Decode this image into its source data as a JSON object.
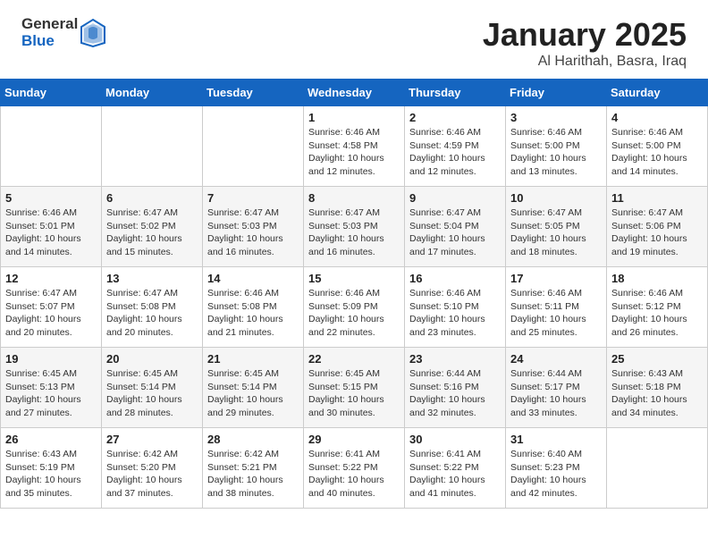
{
  "header": {
    "logo_general": "General",
    "logo_blue": "Blue",
    "title": "January 2025",
    "subtitle": "Al Harithah, Basra, Iraq"
  },
  "calendar": {
    "days_of_week": [
      "Sunday",
      "Monday",
      "Tuesday",
      "Wednesday",
      "Thursday",
      "Friday",
      "Saturday"
    ],
    "weeks": [
      [
        {
          "day": "",
          "info": ""
        },
        {
          "day": "",
          "info": ""
        },
        {
          "day": "",
          "info": ""
        },
        {
          "day": "1",
          "info": "Sunrise: 6:46 AM\nSunset: 4:58 PM\nDaylight: 10 hours\nand 12 minutes."
        },
        {
          "day": "2",
          "info": "Sunrise: 6:46 AM\nSunset: 4:59 PM\nDaylight: 10 hours\nand 12 minutes."
        },
        {
          "day": "3",
          "info": "Sunrise: 6:46 AM\nSunset: 5:00 PM\nDaylight: 10 hours\nand 13 minutes."
        },
        {
          "day": "4",
          "info": "Sunrise: 6:46 AM\nSunset: 5:00 PM\nDaylight: 10 hours\nand 14 minutes."
        }
      ],
      [
        {
          "day": "5",
          "info": "Sunrise: 6:46 AM\nSunset: 5:01 PM\nDaylight: 10 hours\nand 14 minutes."
        },
        {
          "day": "6",
          "info": "Sunrise: 6:47 AM\nSunset: 5:02 PM\nDaylight: 10 hours\nand 15 minutes."
        },
        {
          "day": "7",
          "info": "Sunrise: 6:47 AM\nSunset: 5:03 PM\nDaylight: 10 hours\nand 16 minutes."
        },
        {
          "day": "8",
          "info": "Sunrise: 6:47 AM\nSunset: 5:03 PM\nDaylight: 10 hours\nand 16 minutes."
        },
        {
          "day": "9",
          "info": "Sunrise: 6:47 AM\nSunset: 5:04 PM\nDaylight: 10 hours\nand 17 minutes."
        },
        {
          "day": "10",
          "info": "Sunrise: 6:47 AM\nSunset: 5:05 PM\nDaylight: 10 hours\nand 18 minutes."
        },
        {
          "day": "11",
          "info": "Sunrise: 6:47 AM\nSunset: 5:06 PM\nDaylight: 10 hours\nand 19 minutes."
        }
      ],
      [
        {
          "day": "12",
          "info": "Sunrise: 6:47 AM\nSunset: 5:07 PM\nDaylight: 10 hours\nand 20 minutes."
        },
        {
          "day": "13",
          "info": "Sunrise: 6:47 AM\nSunset: 5:08 PM\nDaylight: 10 hours\nand 20 minutes."
        },
        {
          "day": "14",
          "info": "Sunrise: 6:46 AM\nSunset: 5:08 PM\nDaylight: 10 hours\nand 21 minutes."
        },
        {
          "day": "15",
          "info": "Sunrise: 6:46 AM\nSunset: 5:09 PM\nDaylight: 10 hours\nand 22 minutes."
        },
        {
          "day": "16",
          "info": "Sunrise: 6:46 AM\nSunset: 5:10 PM\nDaylight: 10 hours\nand 23 minutes."
        },
        {
          "day": "17",
          "info": "Sunrise: 6:46 AM\nSunset: 5:11 PM\nDaylight: 10 hours\nand 25 minutes."
        },
        {
          "day": "18",
          "info": "Sunrise: 6:46 AM\nSunset: 5:12 PM\nDaylight: 10 hours\nand 26 minutes."
        }
      ],
      [
        {
          "day": "19",
          "info": "Sunrise: 6:45 AM\nSunset: 5:13 PM\nDaylight: 10 hours\nand 27 minutes."
        },
        {
          "day": "20",
          "info": "Sunrise: 6:45 AM\nSunset: 5:14 PM\nDaylight: 10 hours\nand 28 minutes."
        },
        {
          "day": "21",
          "info": "Sunrise: 6:45 AM\nSunset: 5:14 PM\nDaylight: 10 hours\nand 29 minutes."
        },
        {
          "day": "22",
          "info": "Sunrise: 6:45 AM\nSunset: 5:15 PM\nDaylight: 10 hours\nand 30 minutes."
        },
        {
          "day": "23",
          "info": "Sunrise: 6:44 AM\nSunset: 5:16 PM\nDaylight: 10 hours\nand 32 minutes."
        },
        {
          "day": "24",
          "info": "Sunrise: 6:44 AM\nSunset: 5:17 PM\nDaylight: 10 hours\nand 33 minutes."
        },
        {
          "day": "25",
          "info": "Sunrise: 6:43 AM\nSunset: 5:18 PM\nDaylight: 10 hours\nand 34 minutes."
        }
      ],
      [
        {
          "day": "26",
          "info": "Sunrise: 6:43 AM\nSunset: 5:19 PM\nDaylight: 10 hours\nand 35 minutes."
        },
        {
          "day": "27",
          "info": "Sunrise: 6:42 AM\nSunset: 5:20 PM\nDaylight: 10 hours\nand 37 minutes."
        },
        {
          "day": "28",
          "info": "Sunrise: 6:42 AM\nSunset: 5:21 PM\nDaylight: 10 hours\nand 38 minutes."
        },
        {
          "day": "29",
          "info": "Sunrise: 6:41 AM\nSunset: 5:22 PM\nDaylight: 10 hours\nand 40 minutes."
        },
        {
          "day": "30",
          "info": "Sunrise: 6:41 AM\nSunset: 5:22 PM\nDaylight: 10 hours\nand 41 minutes."
        },
        {
          "day": "31",
          "info": "Sunrise: 6:40 AM\nSunset: 5:23 PM\nDaylight: 10 hours\nand 42 minutes."
        },
        {
          "day": "",
          "info": ""
        }
      ]
    ]
  }
}
